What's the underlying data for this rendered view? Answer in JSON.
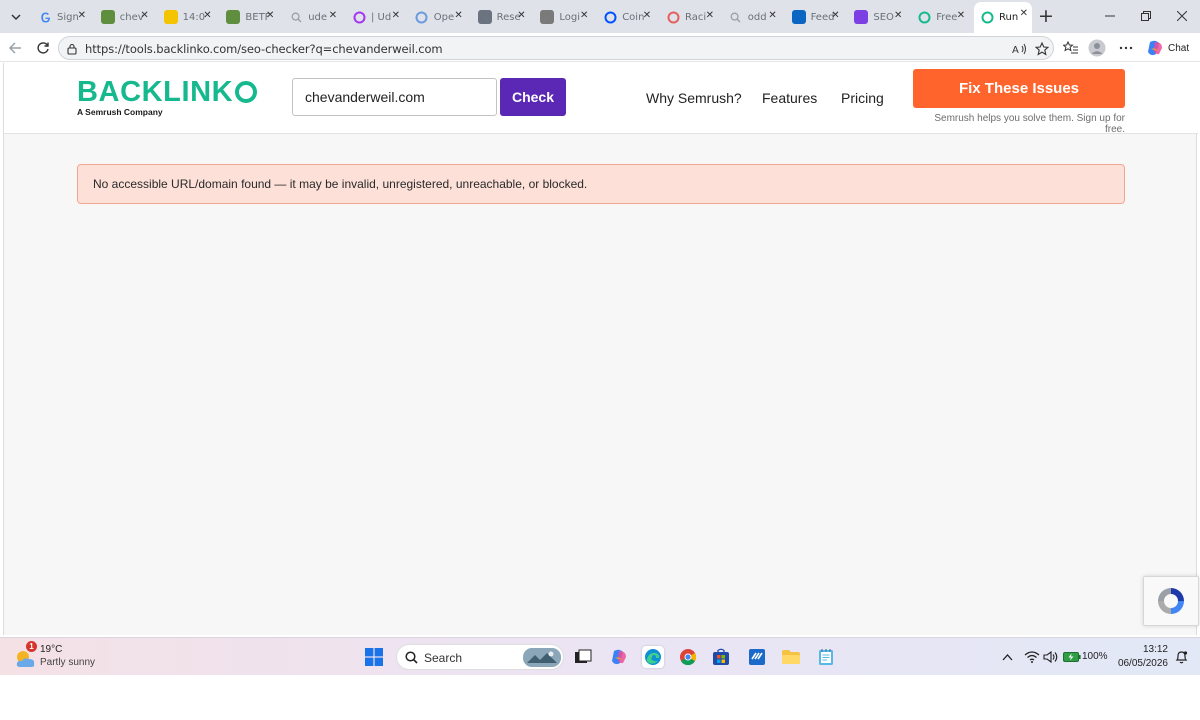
{
  "browser": {
    "tabs": [
      {
        "title": "Sign",
        "favicon": "google-icon",
        "color": "#4285f4"
      },
      {
        "title": "chev",
        "favicon": "shopify-icon",
        "color": "#5e8e3e"
      },
      {
        "title": "14:0",
        "favicon": "betfair-icon",
        "color": "#f5c400"
      },
      {
        "title": "BETF",
        "favicon": "shopify-icon",
        "color": "#5e8e3e"
      },
      {
        "title": "ude",
        "favicon": "search-icon",
        "color": "#9aa0a6"
      },
      {
        "title": "| Ud",
        "favicon": "udemy-icon",
        "color": "#a435f0"
      },
      {
        "title": "Ope",
        "favicon": "openai-icon",
        "color": "#6a9be0"
      },
      {
        "title": "Rese",
        "favicon": "research-icon",
        "color": "#6b7280"
      },
      {
        "title": "Logi",
        "favicon": "login-icon",
        "color": "#7a7a7a"
      },
      {
        "title": "Coin",
        "favicon": "coinbase-icon",
        "color": "#0052ff"
      },
      {
        "title": "Raci",
        "favicon": "racing-icon",
        "color": "#e4605e"
      },
      {
        "title": "odd",
        "favicon": "search-icon",
        "color": "#9aa0a6"
      },
      {
        "title": "Feed",
        "favicon": "linkedin-icon",
        "color": "#0a66c2"
      },
      {
        "title": "SEO",
        "favicon": "semrush-icon",
        "color": "#7b3fe4"
      },
      {
        "title": "Free",
        "favicon": "backlinko-icon",
        "color": "#16b98d"
      },
      {
        "title": "Run",
        "favicon": "backlinko-icon",
        "color": "#16b98d",
        "active": true
      }
    ],
    "url": "https://tools.backlinko.com/seo-checker?q=chevanderweil.com",
    "chat_label": "Chat"
  },
  "site": {
    "logo_text": "BACKLINK",
    "logo_subtitle": "A Semrush Company",
    "search_value": "chevanderweil.com",
    "check_label": "Check",
    "nav": [
      "Why Semrush?",
      "Features",
      "Pricing"
    ],
    "cta_label": "Fix These Issues",
    "cta_subtext": "Semrush helps you solve them. Sign up for free.",
    "alert_text": "No accessible URL/domain found — it may be invalid, unregistered, unreachable, or blocked.",
    "brand_color": "#16b98d",
    "check_color": "#5b28b5",
    "cta_color": "#ff642d"
  },
  "taskbar": {
    "weather_temp": "19°C",
    "weather_condition": "Partly sunny",
    "weather_badge": "1",
    "search_label": "Search",
    "battery": "100%",
    "time": "13:12",
    "date": "06/05/2026"
  }
}
